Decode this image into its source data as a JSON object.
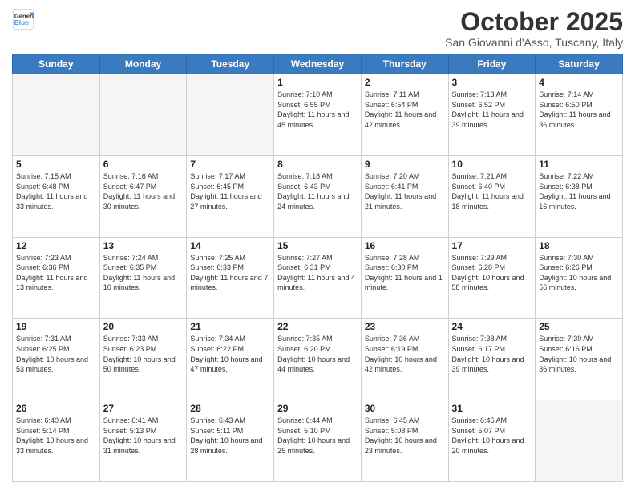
{
  "header": {
    "logo_line1": "General",
    "logo_line2": "Blue",
    "month": "October 2025",
    "location": "San Giovanni d'Asso, Tuscany, Italy"
  },
  "days_of_week": [
    "Sunday",
    "Monday",
    "Tuesday",
    "Wednesday",
    "Thursday",
    "Friday",
    "Saturday"
  ],
  "weeks": [
    [
      {
        "day": "",
        "info": ""
      },
      {
        "day": "",
        "info": ""
      },
      {
        "day": "",
        "info": ""
      },
      {
        "day": "1",
        "info": "Sunrise: 7:10 AM\nSunset: 6:55 PM\nDaylight: 11 hours and 45 minutes."
      },
      {
        "day": "2",
        "info": "Sunrise: 7:11 AM\nSunset: 6:54 PM\nDaylight: 11 hours and 42 minutes."
      },
      {
        "day": "3",
        "info": "Sunrise: 7:13 AM\nSunset: 6:52 PM\nDaylight: 11 hours and 39 minutes."
      },
      {
        "day": "4",
        "info": "Sunrise: 7:14 AM\nSunset: 6:50 PM\nDaylight: 11 hours and 36 minutes."
      }
    ],
    [
      {
        "day": "5",
        "info": "Sunrise: 7:15 AM\nSunset: 6:48 PM\nDaylight: 11 hours and 33 minutes."
      },
      {
        "day": "6",
        "info": "Sunrise: 7:16 AM\nSunset: 6:47 PM\nDaylight: 11 hours and 30 minutes."
      },
      {
        "day": "7",
        "info": "Sunrise: 7:17 AM\nSunset: 6:45 PM\nDaylight: 11 hours and 27 minutes."
      },
      {
        "day": "8",
        "info": "Sunrise: 7:18 AM\nSunset: 6:43 PM\nDaylight: 11 hours and 24 minutes."
      },
      {
        "day": "9",
        "info": "Sunrise: 7:20 AM\nSunset: 6:41 PM\nDaylight: 11 hours and 21 minutes."
      },
      {
        "day": "10",
        "info": "Sunrise: 7:21 AM\nSunset: 6:40 PM\nDaylight: 11 hours and 18 minutes."
      },
      {
        "day": "11",
        "info": "Sunrise: 7:22 AM\nSunset: 6:38 PM\nDaylight: 11 hours and 16 minutes."
      }
    ],
    [
      {
        "day": "12",
        "info": "Sunrise: 7:23 AM\nSunset: 6:36 PM\nDaylight: 11 hours and 13 minutes."
      },
      {
        "day": "13",
        "info": "Sunrise: 7:24 AM\nSunset: 6:35 PM\nDaylight: 11 hours and 10 minutes."
      },
      {
        "day": "14",
        "info": "Sunrise: 7:25 AM\nSunset: 6:33 PM\nDaylight: 11 hours and 7 minutes."
      },
      {
        "day": "15",
        "info": "Sunrise: 7:27 AM\nSunset: 6:31 PM\nDaylight: 11 hours and 4 minutes."
      },
      {
        "day": "16",
        "info": "Sunrise: 7:28 AM\nSunset: 6:30 PM\nDaylight: 11 hours and 1 minute."
      },
      {
        "day": "17",
        "info": "Sunrise: 7:29 AM\nSunset: 6:28 PM\nDaylight: 10 hours and 58 minutes."
      },
      {
        "day": "18",
        "info": "Sunrise: 7:30 AM\nSunset: 6:26 PM\nDaylight: 10 hours and 56 minutes."
      }
    ],
    [
      {
        "day": "19",
        "info": "Sunrise: 7:31 AM\nSunset: 6:25 PM\nDaylight: 10 hours and 53 minutes."
      },
      {
        "day": "20",
        "info": "Sunrise: 7:33 AM\nSunset: 6:23 PM\nDaylight: 10 hours and 50 minutes."
      },
      {
        "day": "21",
        "info": "Sunrise: 7:34 AM\nSunset: 6:22 PM\nDaylight: 10 hours and 47 minutes."
      },
      {
        "day": "22",
        "info": "Sunrise: 7:35 AM\nSunset: 6:20 PM\nDaylight: 10 hours and 44 minutes."
      },
      {
        "day": "23",
        "info": "Sunrise: 7:36 AM\nSunset: 6:19 PM\nDaylight: 10 hours and 42 minutes."
      },
      {
        "day": "24",
        "info": "Sunrise: 7:38 AM\nSunset: 6:17 PM\nDaylight: 10 hours and 39 minutes."
      },
      {
        "day": "25",
        "info": "Sunrise: 7:39 AM\nSunset: 6:16 PM\nDaylight: 10 hours and 36 minutes."
      }
    ],
    [
      {
        "day": "26",
        "info": "Sunrise: 6:40 AM\nSunset: 5:14 PM\nDaylight: 10 hours and 33 minutes."
      },
      {
        "day": "27",
        "info": "Sunrise: 6:41 AM\nSunset: 5:13 PM\nDaylight: 10 hours and 31 minutes."
      },
      {
        "day": "28",
        "info": "Sunrise: 6:43 AM\nSunset: 5:11 PM\nDaylight: 10 hours and 28 minutes."
      },
      {
        "day": "29",
        "info": "Sunrise: 6:44 AM\nSunset: 5:10 PM\nDaylight: 10 hours and 25 minutes."
      },
      {
        "day": "30",
        "info": "Sunrise: 6:45 AM\nSunset: 5:08 PM\nDaylight: 10 hours and 23 minutes."
      },
      {
        "day": "31",
        "info": "Sunrise: 6:46 AM\nSunset: 5:07 PM\nDaylight: 10 hours and 20 minutes."
      },
      {
        "day": "",
        "info": ""
      }
    ]
  ]
}
